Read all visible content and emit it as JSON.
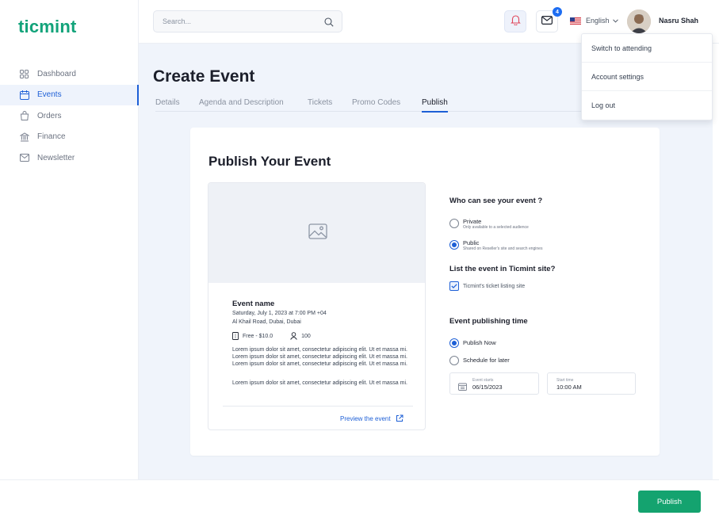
{
  "app": {
    "logo": "ticmint",
    "brand_color": "#12a37a",
    "accent_color": "#1d5fd6"
  },
  "sidebar": {
    "items": [
      {
        "label": "Dashboard",
        "icon": "grid-icon"
      },
      {
        "label": "Events",
        "icon": "calendar-icon",
        "active": true
      },
      {
        "label": "Orders",
        "icon": "bag-icon"
      },
      {
        "label": "Finance",
        "icon": "bank-icon"
      },
      {
        "label": "Newsletter",
        "icon": "envelope-icon"
      }
    ]
  },
  "header": {
    "search_placeholder": "Search...",
    "mail_badge": "4",
    "language": "English",
    "user_name": "Nasru Shah"
  },
  "user_menu": {
    "items": [
      "Switch to attending",
      "Account settings",
      "Log out"
    ]
  },
  "page": {
    "title": "Create Event",
    "tabs": [
      "Details",
      "Agenda and Description",
      "Tickets",
      "Promo Codes",
      "Publish"
    ],
    "active_tab": "Publish"
  },
  "publish": {
    "title": "Publish Your Event",
    "preview": {
      "event_name": "Event name",
      "date": "Saturday, July 1, 2023 at 7:00 PM +04",
      "location": "Al Khail Road, Dubai, Dubai",
      "price": "Free - $10.0",
      "capacity": "100",
      "description_1": "Lorem ipsum dolor sit amet, consectetur adipiscing elit. Ut et massa mi.  Lorem ipsum dolor sit amet, consectetur adipiscing elit. Ut et massa mi.  Lorem ipsum dolor sit amet, consectetur adipiscing elit. Ut et massa mi.",
      "description_2": "Lorem ipsum dolor sit amet, consectetur adipiscing elit. Ut et massa mi.",
      "preview_link": "Preview the event"
    },
    "visibility": {
      "title": "Who can see your event ?",
      "private_label": "Private",
      "private_sub": "Only available to a selected audience",
      "public_label": "Public",
      "public_sub": "Shared on Reseller's site and search engines",
      "selected": "Public"
    },
    "listing": {
      "title": "List the event in Ticmint site?",
      "checkbox_label": "Ticmint's ticket listing site",
      "checked": true
    },
    "timing": {
      "title": "Event publishing time",
      "now_label": "Publish Now",
      "later_label": "Schedule for later",
      "selected": "Publish Now",
      "start_label": "Event starts",
      "start_value": "06/15/2023",
      "time_label": "Start time",
      "time_value": "10:00 AM"
    }
  },
  "footer": {
    "publish_label": "Publish",
    "publish_color": "#14a36f"
  }
}
